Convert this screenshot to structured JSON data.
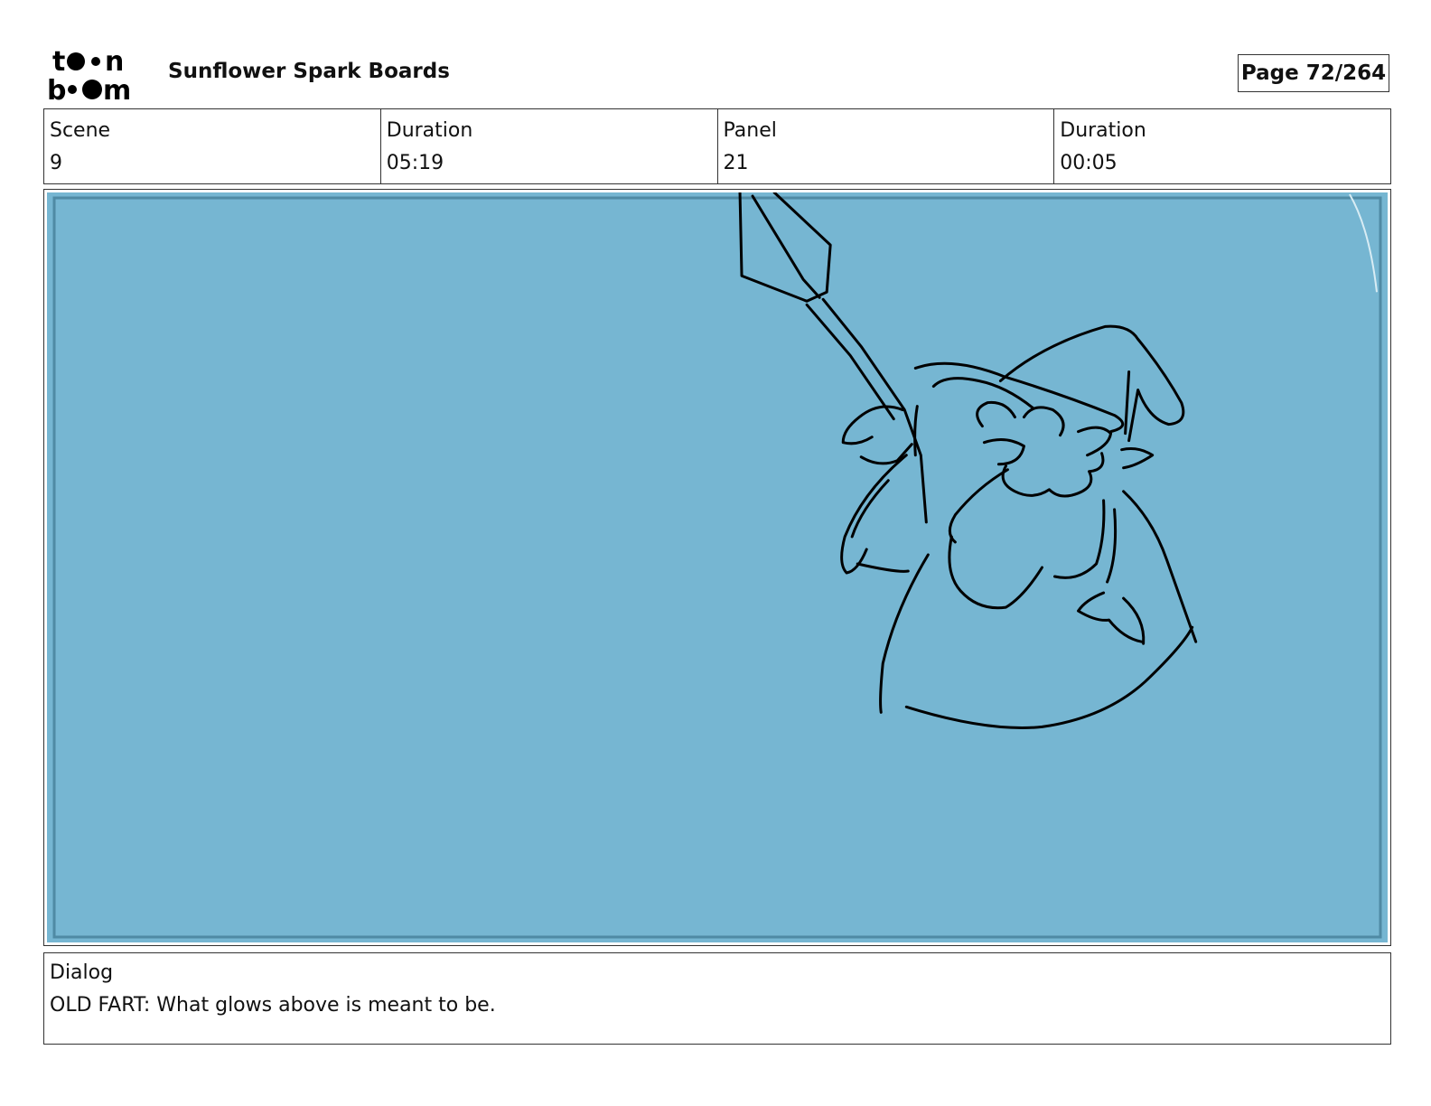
{
  "header": {
    "logo_text": "toon boom",
    "project_title": "Sunflower Spark Boards",
    "page_label": "Page",
    "page_number": "72/264"
  },
  "info": [
    {
      "label": "Scene",
      "value": "9"
    },
    {
      "label": "Duration",
      "value": "05:19"
    },
    {
      "label": "Panel",
      "value": "21"
    },
    {
      "label": "Duration",
      "value": "00:05"
    }
  ],
  "panel": {
    "background_color": "#76b6d2",
    "border_color": "#4f8aa4",
    "line_color": "#000000"
  },
  "dialog": {
    "label": "Dialog",
    "text": "OLD FART: What glows above is meant to be."
  }
}
